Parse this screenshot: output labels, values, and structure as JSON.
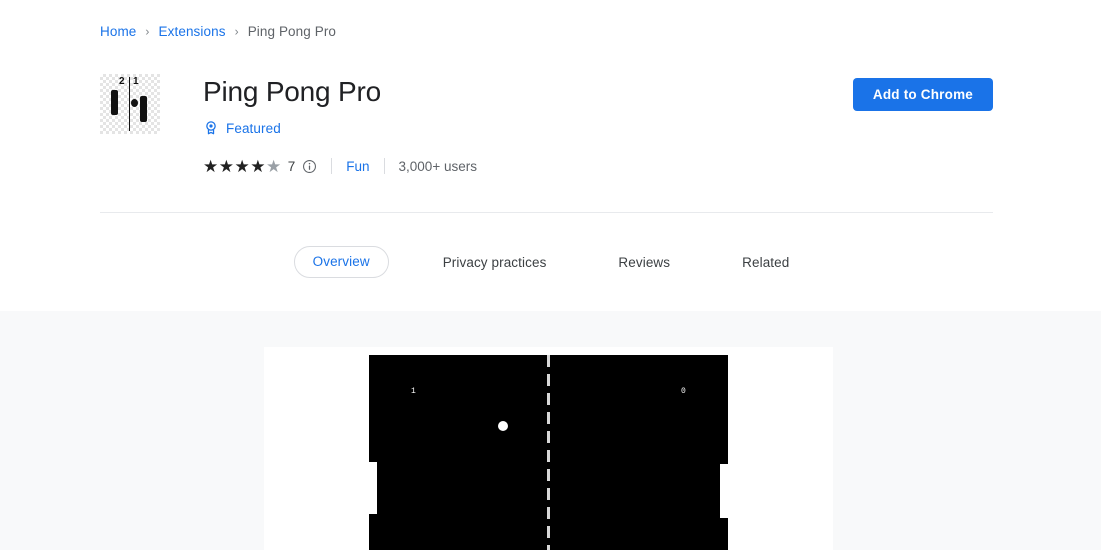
{
  "breadcrumb": {
    "items": [
      {
        "label": "Home",
        "type": "link"
      },
      {
        "label": "Extensions",
        "type": "link"
      },
      {
        "label": "Ping Pong Pro",
        "type": "current"
      }
    ],
    "separator": "›"
  },
  "extension": {
    "title": "Ping Pong Pro",
    "icon": {
      "name": "ping-pong-extension-icon",
      "score_left": "2",
      "score_right": "1"
    },
    "featured": {
      "label": "Featured",
      "icon": "award-badge-icon",
      "color": "#1a73e8"
    },
    "rating": {
      "stars_filled": 4,
      "stars_empty": 1,
      "star_glyph": "★",
      "count": "7",
      "info_icon": "info-circle-icon"
    },
    "category": "Fun",
    "users": "3,000+ users"
  },
  "cta": {
    "label": "Add to Chrome",
    "color": "#1a73e8"
  },
  "tabs": [
    {
      "label": "Overview",
      "active": true
    },
    {
      "label": "Privacy practices",
      "active": false
    },
    {
      "label": "Reviews",
      "active": false
    },
    {
      "label": "Related",
      "active": false
    }
  ],
  "screenshot": {
    "name": "pong-gameplay-screenshot",
    "background": "#000000",
    "score_left": "1",
    "score_right": "0",
    "elements": [
      "center-net",
      "ball",
      "left-paddle",
      "right-paddle"
    ]
  }
}
